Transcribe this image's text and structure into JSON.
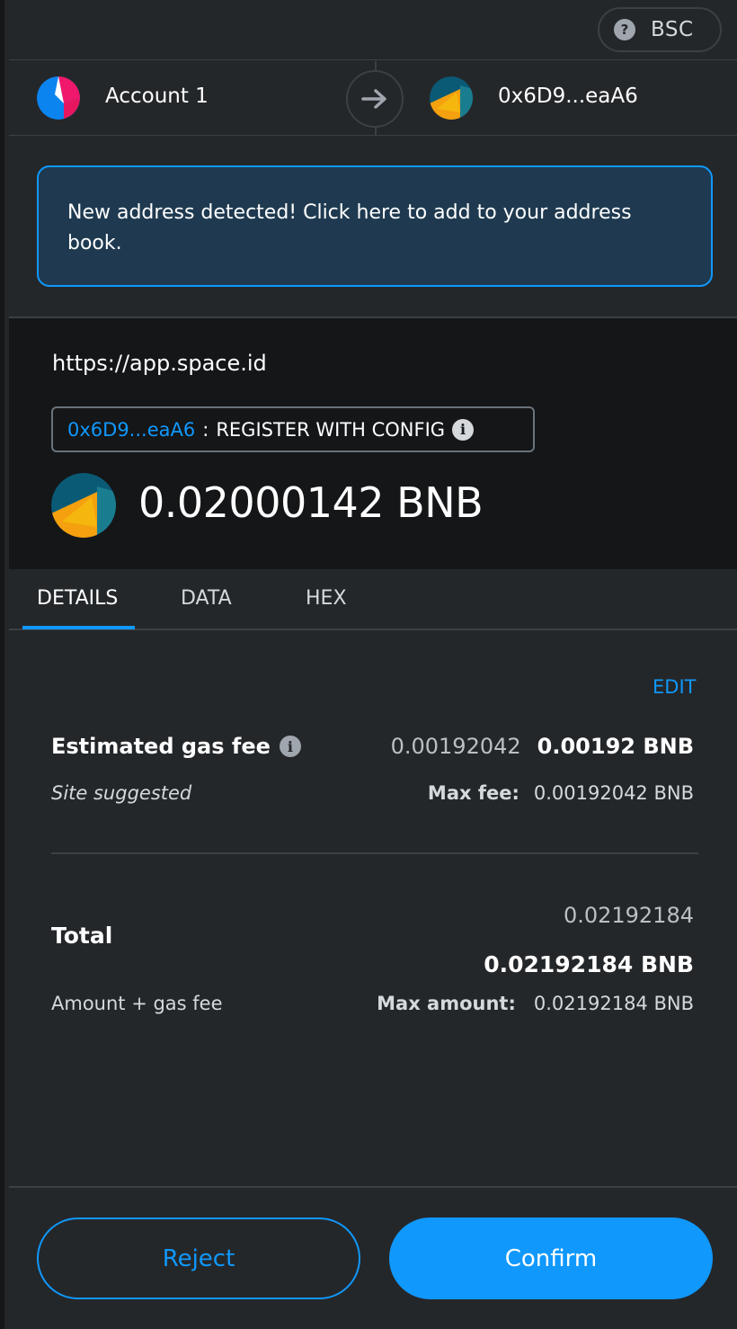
{
  "network": {
    "name": "BSC",
    "help_glyph": "?"
  },
  "sender": {
    "name": "Account 1",
    "avatar_colors": [
      "#0b84f0",
      "#f0186a",
      "#ffffff"
    ]
  },
  "recipient": {
    "address": "0x6D9...eaA6",
    "avatar_colors": [
      "#0a5a76",
      "#f5a00e",
      "#1a7d8f"
    ]
  },
  "banner": {
    "text": "New address detected! Click here to add to your address book."
  },
  "origin": {
    "url": "https://app.space.id",
    "method_address": "0x6D9...eaA6",
    "method_separator": ":",
    "method_name": "REGISTER WITH CONFIG",
    "info_glyph": "i",
    "amount": "0.02000142 BNB"
  },
  "tabs": [
    "DETAILS",
    "DATA",
    "HEX"
  ],
  "details": {
    "edit": "EDIT",
    "gas_title": "Estimated gas fee",
    "gas_fiat": "0.00192042",
    "gas_native": "0.00192 BNB",
    "site_suggested": "Site suggested",
    "max_fee_label": "Max fee:",
    "max_fee_value": "0.00192042 BNB",
    "total_title": "Total",
    "total_fiat": "0.02192184",
    "total_native": "0.02192184 BNB",
    "total_sub": "Amount + gas fee",
    "max_amount_label": "Max amount:",
    "max_amount_value": "0.02192184 BNB"
  },
  "buttons": {
    "reject": "Reject",
    "confirm": "Confirm"
  },
  "colors": {
    "accent": "#1098fc",
    "background": "#24272a",
    "origin_bg": "#141618",
    "banner_bg": "#1f3a50"
  }
}
